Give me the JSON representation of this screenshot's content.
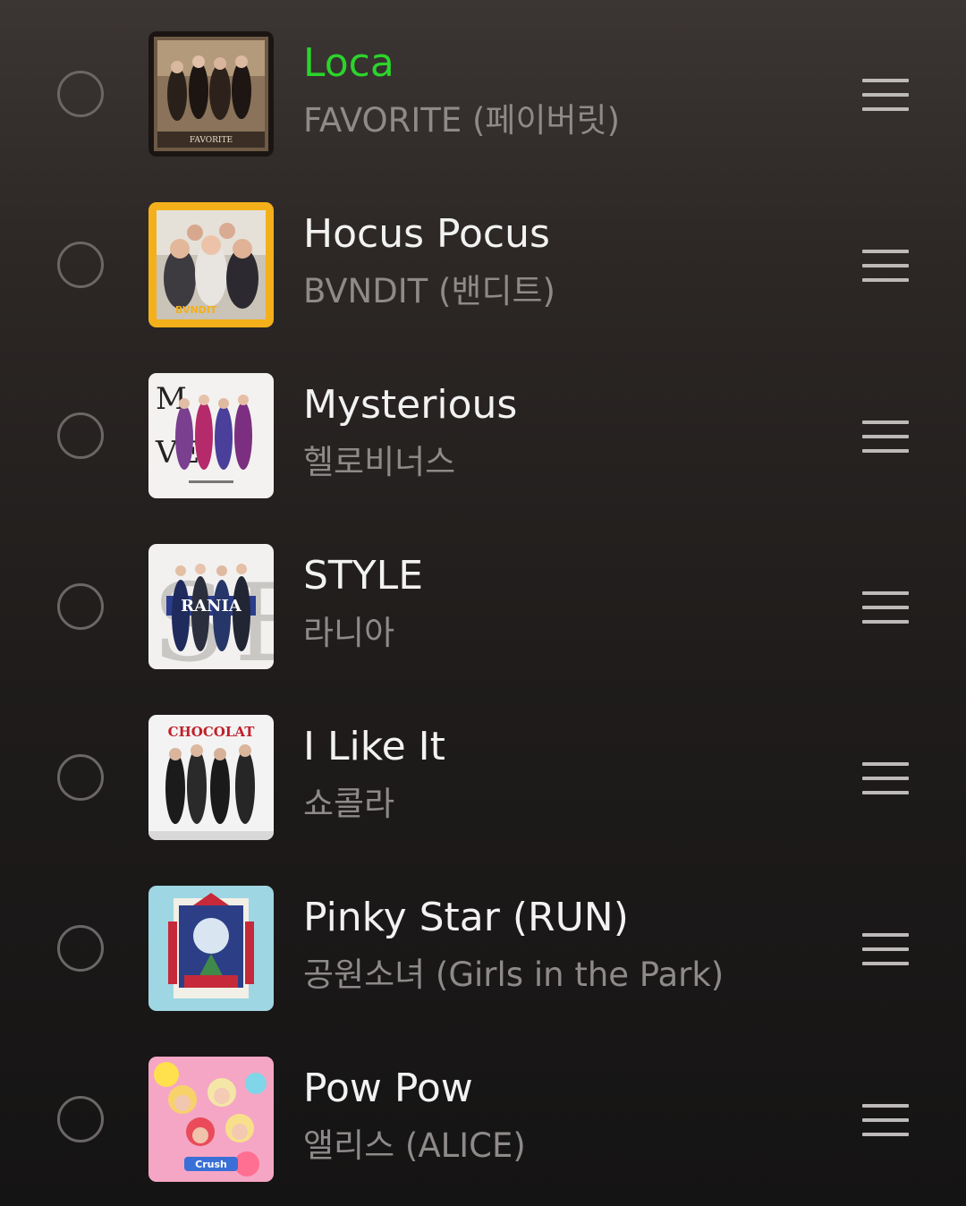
{
  "playlist": {
    "tracks": [
      {
        "title": "Loca",
        "artist": "FAVORITE (페이버릿)",
        "active": true,
        "cover_icon": "album-cover-favorite"
      },
      {
        "title": "Hocus Pocus",
        "artist": "BVNDIT (밴디트)",
        "active": false,
        "cover_icon": "album-cover-bvndit"
      },
      {
        "title": "Mysterious",
        "artist": "헬로비너스",
        "active": false,
        "cover_icon": "album-cover-hello-venus"
      },
      {
        "title": "STYLE",
        "artist": "라니아",
        "active": false,
        "cover_icon": "album-cover-rania"
      },
      {
        "title": "I Like It",
        "artist": "쇼콜라",
        "active": false,
        "cover_icon": "album-cover-chocolat"
      },
      {
        "title": "Pinky Star (RUN)",
        "artist": "공원소녀 (Girls in the Park)",
        "active": false,
        "cover_icon": "album-cover-girls-in-the-park"
      },
      {
        "title": "Pow Pow",
        "artist": "앨리스 (ALICE)",
        "active": false,
        "cover_icon": "album-cover-alice"
      }
    ]
  },
  "colors": {
    "active_title": "#2bd42b",
    "title": "#f2f2f2",
    "artist": "#8e8a89",
    "background_top": "#3b3533",
    "background_bottom": "#151414"
  }
}
